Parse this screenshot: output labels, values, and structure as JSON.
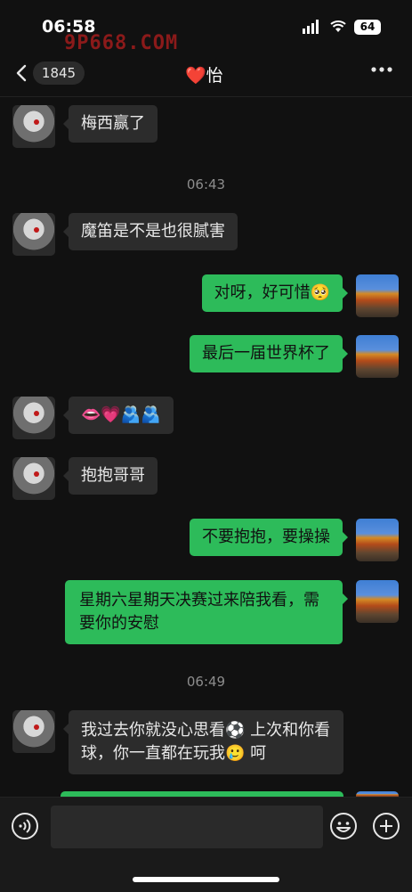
{
  "status": {
    "time": "06:58",
    "battery": "64",
    "watermark": "9P668.COM"
  },
  "header": {
    "unread_count": "1845",
    "title": "❤️怡"
  },
  "messages": [
    {
      "side": "left",
      "text": "梅西赢了"
    },
    {
      "timestamp": "06:43"
    },
    {
      "side": "left",
      "text": "魔笛是不是也很腻害"
    },
    {
      "side": "right",
      "text": "对呀，好可惜🥺"
    },
    {
      "side": "right",
      "text": "最后一届世界杯了"
    },
    {
      "side": "left",
      "text": "👄💗🫂🫂"
    },
    {
      "side": "left",
      "text": "抱抱哥哥"
    },
    {
      "side": "right",
      "text": "不要抱抱，要操操"
    },
    {
      "side": "right",
      "text": "星期六星期天决赛过来陪我看，需要你的安慰"
    },
    {
      "timestamp": "06:49"
    },
    {
      "side": "left",
      "text": "我过去你就没心思看⚽️ 上次和你看球，你一直都在玩我🥲 呵"
    }
  ],
  "input": {
    "placeholder": ""
  },
  "icons": {
    "back": "chevron-left-icon",
    "more": "more-dots-icon",
    "voice": "voice-icon",
    "emoji": "emoji-icon",
    "plus": "plus-icon"
  },
  "colors": {
    "sent_bubble": "#2dbb5a",
    "received_bubble": "#2c2c2c",
    "background": "#111111"
  }
}
